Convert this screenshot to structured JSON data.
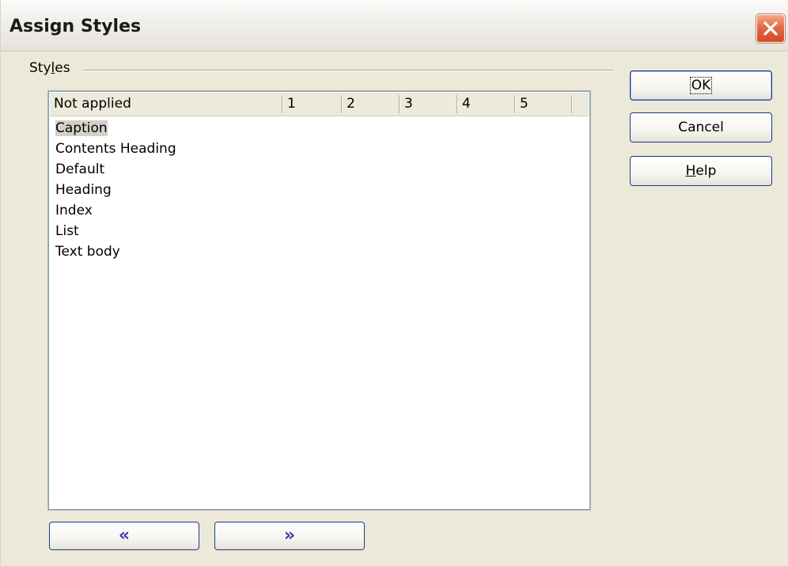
{
  "window": {
    "title": "Assign Styles"
  },
  "icons": {
    "close": "close-icon",
    "move_left": "double-chevron-left-icon",
    "move_right": "double-chevron-right-icon"
  },
  "colors": {
    "close_button": "#e05a37",
    "nav_arrow": "#3a3aa8",
    "selection": "#d4d0c8"
  },
  "styles_group": {
    "label_pre": "Sty",
    "label_mnemonic": "l",
    "label_post": "es",
    "columns": [
      "Not applied",
      "1",
      "2",
      "3",
      "4",
      "5"
    ],
    "items": [
      {
        "label": "Caption",
        "selected": true
      },
      {
        "label": "Contents Heading",
        "selected": false
      },
      {
        "label": "Default",
        "selected": false
      },
      {
        "label": "Heading",
        "selected": false
      },
      {
        "label": "Index",
        "selected": false
      },
      {
        "label": "List",
        "selected": false
      },
      {
        "label": "Text body",
        "selected": false
      }
    ]
  },
  "buttons": {
    "ok": "OK",
    "cancel": "Cancel",
    "help_mnemonic": "H",
    "help_rest": "elp",
    "move_left": "«",
    "move_right": "»"
  }
}
